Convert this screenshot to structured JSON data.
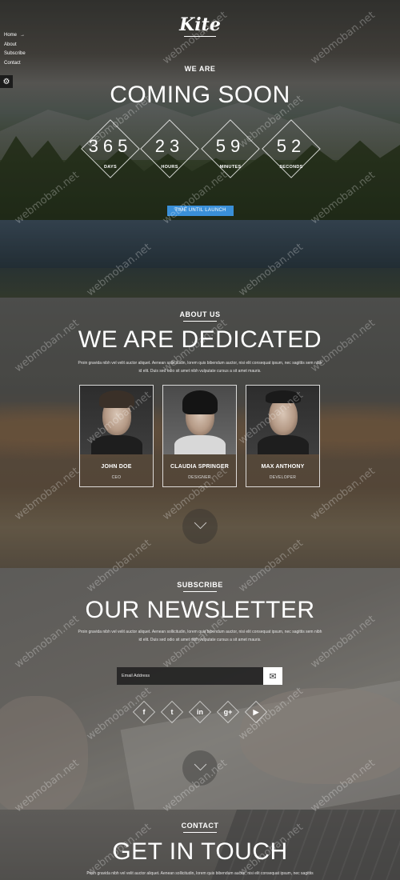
{
  "nav": {
    "items": [
      "Home",
      "About",
      "Subscribe",
      "Contact"
    ],
    "home_arrow": "→"
  },
  "settings_icon": "⚙",
  "hero": {
    "logo": "Kite",
    "kicker": "WE ARE",
    "title": "COMING SOON",
    "countdown": [
      {
        "value": "365",
        "label": "DAYS"
      },
      {
        "value": "23",
        "label": "HOURS"
      },
      {
        "value": "59",
        "label": "MINUTES"
      },
      {
        "value": "52",
        "label": "SECONDS"
      }
    ],
    "cta_label": "TIME UNTIL LAUNCH"
  },
  "about": {
    "kicker": "ABOUT US",
    "title": "WE ARE DEDICATED",
    "paragraph": "Proin gravida nibh vel velit auctor aliquet. Aenean sollicitudin, lorem quis bibendum auctor, nisi elit consequat ipsum, nec sagittis sem nibh id elit. Duis sed odio sit amet nibh vulputate cursus a sit amet mauris.",
    "team": [
      {
        "name": "JOHN DOE",
        "role": "CEO"
      },
      {
        "name": "CLAUDIA SPRINGER",
        "role": "DESIGNER"
      },
      {
        "name": "MAX ANTHONY",
        "role": "DEVELOPER"
      }
    ]
  },
  "newsletter": {
    "kicker": "SUBSCRIBE",
    "title": "OUR NEWSLETTER",
    "paragraph": "Proin gravida nibh vel velit auctor aliquet. Aenean sollicitudin, lorem quis bibendum auctor, nisi elit consequat ipsum, nec sagittis sem nibh id elit. Duis sed odio sit amet nibh vulputate cursus a sit amet mauris.",
    "email_placeholder": "Email Address",
    "submit_icon": "✉",
    "social": [
      {
        "name": "facebook-icon",
        "glyph": "f"
      },
      {
        "name": "twitter-icon",
        "glyph": "t"
      },
      {
        "name": "linkedin-icon",
        "glyph": "in"
      },
      {
        "name": "google-plus-icon",
        "glyph": "g+"
      },
      {
        "name": "youtube-icon",
        "glyph": "▶"
      }
    ]
  },
  "contact": {
    "kicker": "CONTACT",
    "title": "GET IN TOUCH",
    "paragraph": "Proin gravida nibh vel velit auctor aliquet. Aenean sollicitudin, lorem quis bibendum auctor, nisi elit consequat ipsum, nec sagittis"
  },
  "watermark": "webmoban.net",
  "colors": {
    "accent": "#3a8fd8"
  }
}
